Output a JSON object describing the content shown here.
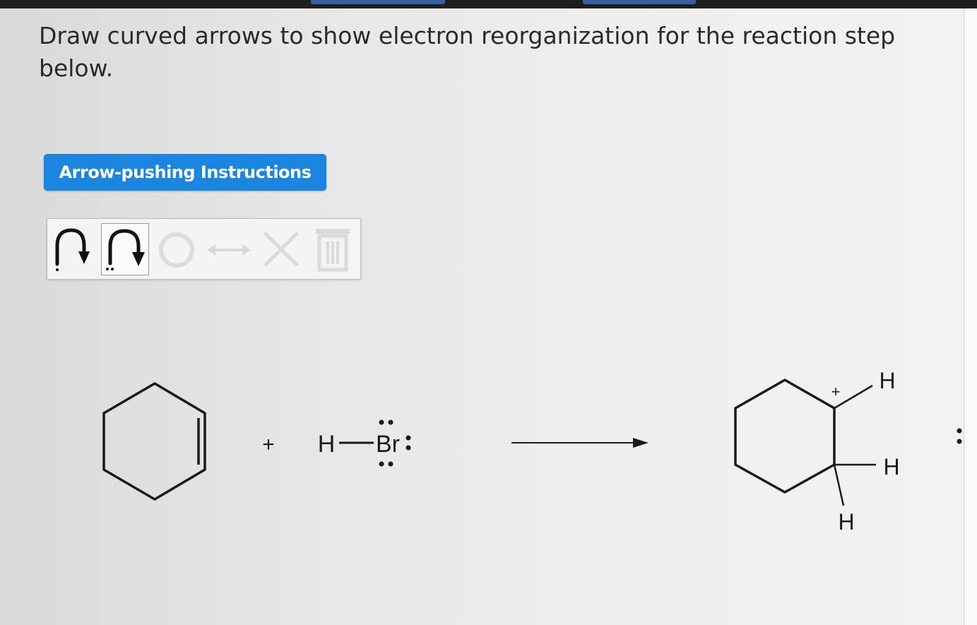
{
  "prompt": {
    "line1": "Draw curved arrows to show electron reorganization for the reaction step",
    "line2": "below."
  },
  "instructions_button": {
    "label": "Arrow-pushing Instructions"
  },
  "toolbar": {
    "tools": [
      {
        "icon": "single-electron-arrow-icon"
      },
      {
        "icon": "electron-pair-arrow-icon",
        "selected": true
      },
      {
        "icon": "cycle-icon",
        "disabled": true
      },
      {
        "icon": "resonance-arrow-icon",
        "disabled": true
      },
      {
        "icon": "delete-x-icon",
        "disabled": true
      },
      {
        "icon": "trash-icon",
        "disabled": true
      }
    ]
  },
  "reaction": {
    "plus": "+",
    "hbr": {
      "h": "H",
      "br": "Br"
    },
    "product": {
      "charge": "+",
      "h_top": "H",
      "h_right": "H",
      "h_bottom": "H"
    },
    "leftover_dots": ":"
  },
  "colors": {
    "accent": "#1a86e0",
    "topbar": "#1e1e1e"
  }
}
